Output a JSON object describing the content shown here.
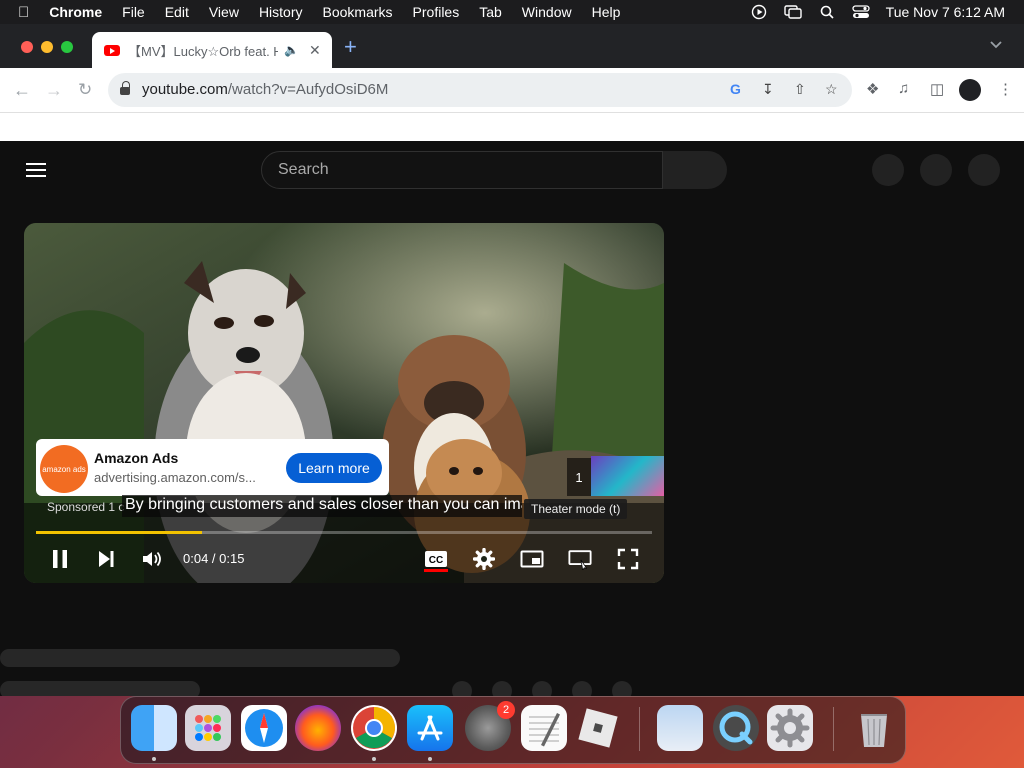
{
  "menubar": {
    "app_name": "Chrome",
    "items": [
      "File",
      "Edit",
      "View",
      "History",
      "Bookmarks",
      "Profiles",
      "Tab",
      "Window",
      "Help"
    ],
    "clock": "Tue Nov 7  6:12 AM"
  },
  "browser": {
    "tab_title": "【MV】Lucky☆Orb feat. Hatsune Miku",
    "address": {
      "host": "youtube.com",
      "path": "/watch?v=AufydOsiD6M"
    }
  },
  "youtube": {
    "search_placeholder": "Search"
  },
  "player": {
    "ad": {
      "advertiser": "Amazon Ads",
      "domain": "advertising.amazon.com/s...",
      "cta": "Learn more",
      "logo_text": "amazon ads",
      "sponsored": "Sponsored 1 c"
    },
    "caption": "By bringing customers and sales closer than you can ima",
    "tooltip": "Theater mode (t)",
    "upnext_count": "1",
    "time": "0:04 / 0:15",
    "progress": 0.27
  },
  "dock": {
    "apps": [
      "Finder",
      "Launchpad",
      "Safari",
      "Firefox",
      "Chrome",
      "App Store",
      "System Preferences",
      "TextEdit",
      "Roblox",
      "Preview",
      "QuickTime Player",
      "System Settings",
      "Trash"
    ],
    "settings_badge": "2"
  },
  "colors": {
    "youtube_bg": "#0f0f0f",
    "cta_blue": "#065fd4",
    "progress_yellow": "#f2c200",
    "youtube_red": "#ff0000"
  }
}
